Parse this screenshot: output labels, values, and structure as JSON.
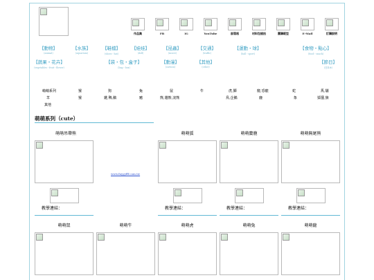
{
  "top_icons": [
    {
      "label": "作品集"
    },
    {
      "label": "FB"
    },
    {
      "label": "IG"
    },
    {
      "label": "YouTube"
    },
    {
      "label": "部落格"
    },
    {
      "label": "材料包搶拍"
    },
    {
      "label": "團購範型"
    },
    {
      "label": "E-Mail"
    },
    {
      "label": "訂購說明"
    }
  ],
  "categories_row1": [
    {
      "label": "【動物】",
      "en": "(animal)"
    },
    {
      "label": "【水族】",
      "en": "(aquarium)"
    },
    {
      "label": "【鞋檔】",
      "en": "(shoes・hat)"
    },
    {
      "label": "【娃娃】",
      "en": "(doll)"
    },
    {
      "label": "【昆蟲】",
      "en": "(insect)"
    },
    {
      "label": "【交通】",
      "en": "(traffic)"
    },
    {
      "label": "【運動・球】",
      "en": "(ball・sport)"
    },
    {
      "label": "【食物・點心】",
      "en": "(food・snack)"
    }
  ],
  "categories_row2": [
    {
      "label": "【蔬果・花卉】",
      "en": "(vegetables・fruit・flower)"
    },
    {
      "label": "【袋・包・盒子】",
      "en": "(bag・box)"
    },
    {
      "label": "【動漫】",
      "en": "(cartoon)"
    },
    {
      "label": "【其他】",
      "en": "(other)"
    },
    {
      "label": "【節日】",
      "en": "(日本木)"
    }
  ],
  "zodiac": {
    "row1": [
      "萌萌系列",
      "猴",
      "狗",
      "兔",
      "鼠",
      "牛",
      "虎,獅",
      "龍,恐龍",
      "蛇",
      "馬,驢"
    ],
    "row2": [
      "羊",
      "猴",
      "雞,鴨,鵝",
      "豬",
      "熊,貓熊,浣熊",
      "鳥,企鵝",
      "鹿",
      "象",
      "狐狸,狼"
    ],
    "row3": [
      "其他"
    ]
  },
  "section_title": "萌萌系列（cute）",
  "row1_titles": [
    "萌萌吊帶熊",
    "萌萌狐",
    "萌萌麋鹿",
    "萌萌無尾熊"
  ],
  "link_text": "www.fuyyyfff.com.tw",
  "teach_label": "教學連結：",
  "row2_titles": [
    "萌萌鼠",
    "萌萌牛",
    "萌萌虎",
    "萌萌兔",
    "萌萌龍"
  ]
}
